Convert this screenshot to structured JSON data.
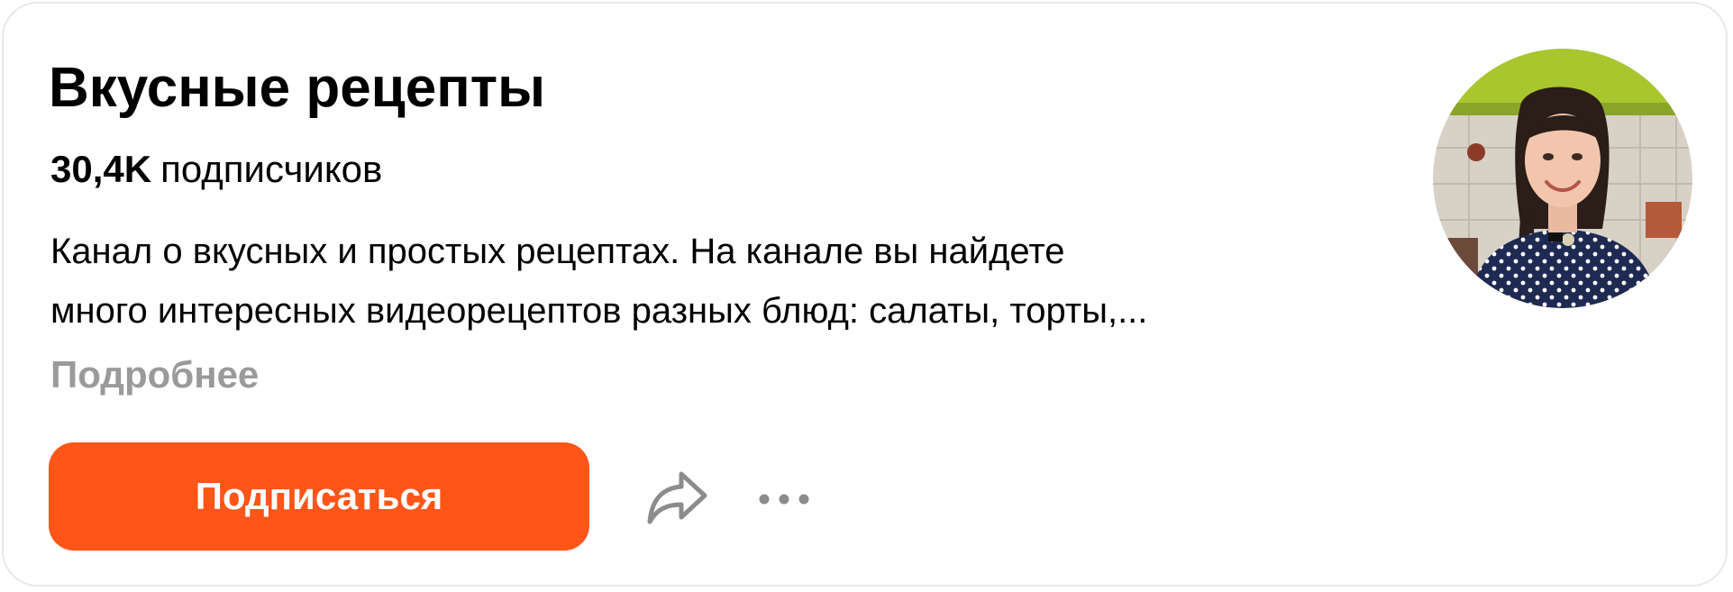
{
  "channel": {
    "title": "Вкусные рецепты",
    "subscribers_count": "30,4K",
    "subscribers_word": "подписчиков",
    "description_lines": [
      "Канал о вкусных и простых рецептах. На канале вы найдете",
      "много интересных видеорецептов разных блюд: салаты, торты,..."
    ],
    "more_label": "Подробнее"
  },
  "actions": {
    "subscribe_label": "Подписаться",
    "share_icon": "share-arrow-icon",
    "more_icon": "more-dots-icon"
  },
  "colors": {
    "accent": "#ff5519",
    "muted_text": "#9a9a9a",
    "icon_gray": "#8c8c8c",
    "border": "#e8e8eb"
  }
}
